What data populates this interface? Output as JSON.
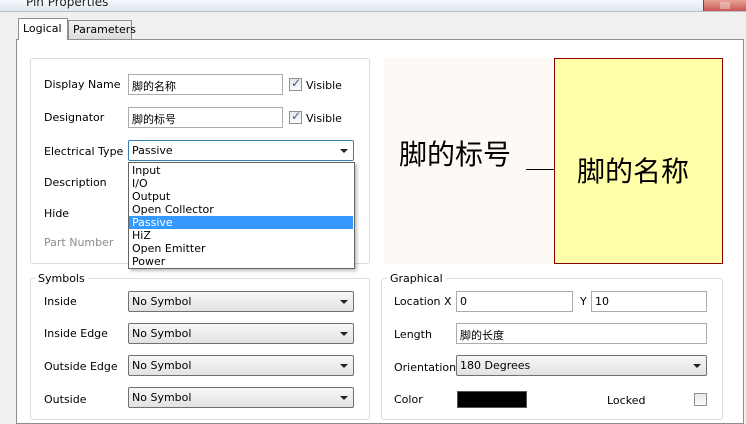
{
  "window": {
    "title": "Pin Properties"
  },
  "tabs": [
    {
      "label": "Logical"
    },
    {
      "label": "Parameters"
    }
  ],
  "logical": {
    "display_name": {
      "label": "Display Name",
      "value": "脚的名称",
      "visible_label": "Visible",
      "visible_checked": true
    },
    "designator": {
      "label": "Designator",
      "value": "脚的标号",
      "visible_label": "Visible",
      "visible_checked": true
    },
    "electrical_type": {
      "label": "Electrical Type",
      "value": "Passive"
    },
    "description": {
      "label": "Description"
    },
    "hide": {
      "label": "Hide"
    },
    "part_number": {
      "label": "Part Number"
    }
  },
  "electrical_type_dropdown": {
    "options": [
      "Input",
      "I/O",
      "Output",
      "Open Collector",
      "Passive",
      "HiZ",
      "Open Emitter",
      "Power"
    ],
    "selected": "Passive"
  },
  "symbols": {
    "legend": "Symbols",
    "inside": {
      "label": "Inside",
      "value": "No Symbol"
    },
    "inside_edge": {
      "label": "Inside Edge",
      "value": "No Symbol"
    },
    "outside_edge": {
      "label": "Outside Edge",
      "value": "No Symbol"
    },
    "outside": {
      "label": "Outside",
      "value": "No Symbol"
    }
  },
  "graphical": {
    "legend": "Graphical",
    "location": {
      "label": "Location",
      "x_label": "X",
      "x_value": "0",
      "y_label": "Y",
      "y_value": "10"
    },
    "length": {
      "label": "Length",
      "value": "脚的长度"
    },
    "orientation": {
      "label": "Orientation",
      "value": "180 Degrees"
    },
    "color": {
      "label": "Color",
      "value": "#000000"
    },
    "locked": {
      "label": "Locked",
      "checked": false
    }
  },
  "preview": {
    "designator_text": "脚的标号",
    "name_text": "脚的名称",
    "body_fill": "#ffffaa",
    "body_border": "#8b0000"
  }
}
